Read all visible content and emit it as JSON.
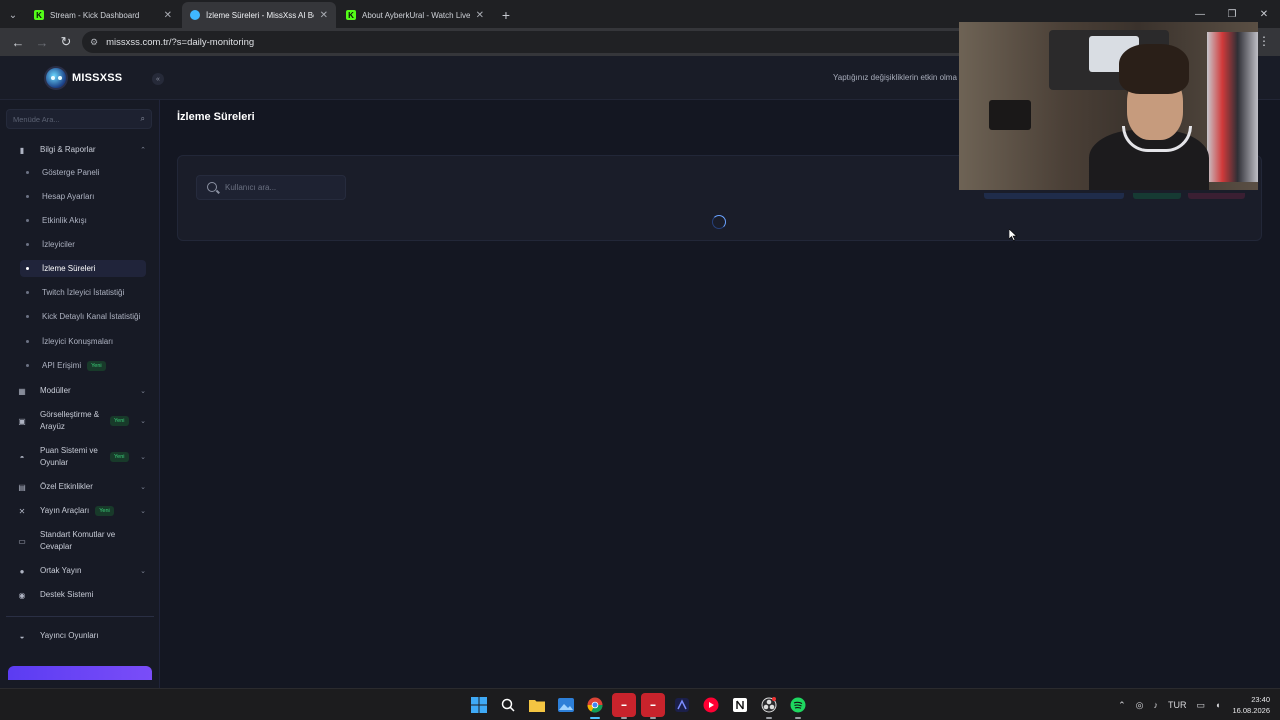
{
  "browser": {
    "tabs": [
      {
        "label": "Stream - Kick Dashboard",
        "favicon": "kick-icon",
        "active": false
      },
      {
        "label": "İzleme Süreleri - MissXss AI Bot",
        "favicon": "missxss-icon",
        "active": true
      },
      {
        "label": "About AyberkUral - Watch Live",
        "favicon": "kick-icon",
        "active": false
      }
    ],
    "url": "missxss.com.tr/?s=daily-monitoring"
  },
  "header": {
    "logo_text": "MISSXSS",
    "notice": "Yaptığınız değişikliklerin etkin olma"
  },
  "sidebar": {
    "search_placeholder": "Menüde Ara...",
    "section_open": {
      "label": "Bilgi & Raporlar",
      "icon": "document-icon"
    },
    "sub_items": [
      {
        "label": "Gösterge Paneli"
      },
      {
        "label": "Hesap Ayarları"
      },
      {
        "label": "Etkinlik Akışı"
      },
      {
        "label": "İzleyiciler"
      },
      {
        "label": "İzleme Süreleri",
        "active": true
      },
      {
        "label": "Twitch İzleyici İstatistiği"
      },
      {
        "label": "Kick Detaylı Kanal İstatistiği"
      },
      {
        "label": "İzleyici Konuşmaları"
      },
      {
        "label": "API Erişimi",
        "badge": "Yeni"
      }
    ],
    "sections": [
      {
        "label": "Modüller",
        "icon": "grid-icon",
        "chevron": true
      },
      {
        "label": "Görselleştirme & Arayüz",
        "icon": "palette-icon",
        "chevron": true,
        "badge": "Yeni"
      },
      {
        "label": "Puan Sistemi ve Oyunlar",
        "icon": "gamepad-icon",
        "chevron": true,
        "badge": "Yeni"
      },
      {
        "label": "Özel Etkinlikler",
        "icon": "calendar-icon",
        "chevron": true
      },
      {
        "label": "Yayın Araçları",
        "icon": "tools-icon",
        "chevron": true,
        "badge": "Yeni"
      },
      {
        "label": "Standart Komutlar ve Cevaplar",
        "icon": "keyboard-icon",
        "chevron": false
      },
      {
        "label": "Ortak Yayın",
        "icon": "users-icon",
        "chevron": true
      },
      {
        "label": "Destek Sistemi",
        "icon": "support-icon",
        "chevron": false
      }
    ],
    "bottom_item": {
      "label": "Yayıncı Oyunları",
      "icon": "controller-icon"
    }
  },
  "main": {
    "title": "İzleme Süreleri",
    "search_placeholder": "Kullanıcı ara..."
  },
  "taskbar": {
    "language": "TUR",
    "time": "23:40",
    "date": "16.08.2026"
  },
  "colors": {
    "background": "#141722",
    "sidebar": "#171a25",
    "accent": "#5b3cf2",
    "badge_green": "#3bd17a"
  }
}
